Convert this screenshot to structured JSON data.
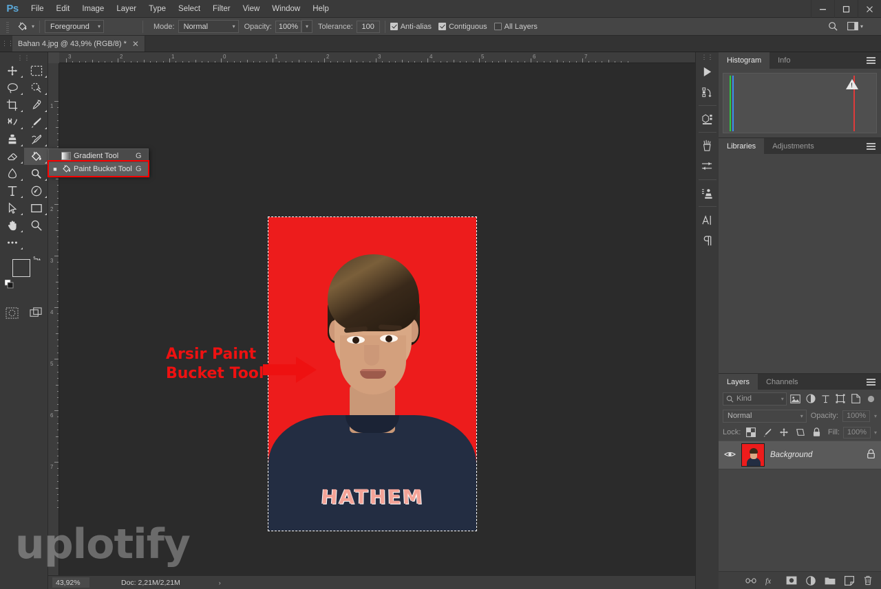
{
  "app": {
    "logo": "Ps",
    "menus": [
      "File",
      "Edit",
      "Image",
      "Layer",
      "Type",
      "Select",
      "Filter",
      "View",
      "Window",
      "Help"
    ],
    "window_controls": {
      "minimize": "—",
      "maximize": "□",
      "close": "✕"
    }
  },
  "options_bar": {
    "tool_icon": "paint-bucket-icon",
    "fill_source": "Foreground",
    "mode_label": "Mode:",
    "mode_value": "Normal",
    "opacity_label": "Opacity:",
    "opacity_value": "100%",
    "tolerance_label": "Tolerance:",
    "tolerance_value": "100",
    "antialias_label": "Anti-alias",
    "antialias_checked": true,
    "contiguous_label": "Contiguous",
    "contiguous_checked": true,
    "all_layers_label": "All Layers",
    "all_layers_checked": false,
    "search_icon": "search-icon",
    "workspace_icon": "workspace-icon"
  },
  "document_tab": {
    "title": "Bahan 4.jpg @ 43,9% (RGB/8) *",
    "close": "✕"
  },
  "toolbar": {
    "tools": [
      {
        "name": "move-tool",
        "glyph": "move"
      },
      {
        "name": "rectangular-marquee-tool",
        "glyph": "marquee"
      },
      {
        "name": "lasso-tool",
        "glyph": "lasso"
      },
      {
        "name": "quick-selection-tool",
        "glyph": "quickselect"
      },
      {
        "name": "crop-tool",
        "glyph": "crop"
      },
      {
        "name": "eyedropper-tool",
        "glyph": "eyedropper"
      },
      {
        "name": "healing-brush-tool",
        "glyph": "heal"
      },
      {
        "name": "brush-tool",
        "glyph": "brush"
      },
      {
        "name": "clone-stamp-tool",
        "glyph": "stamp"
      },
      {
        "name": "history-brush-tool",
        "glyph": "historybrush"
      },
      {
        "name": "eraser-tool",
        "glyph": "eraser"
      },
      {
        "name": "paint-bucket-tool",
        "glyph": "bucket"
      },
      {
        "name": "blur-tool",
        "glyph": "blur"
      },
      {
        "name": "dodge-tool",
        "glyph": "dodge"
      },
      {
        "name": "type-tool",
        "glyph": "type"
      },
      {
        "name": "pen-tool",
        "glyph": "pen"
      },
      {
        "name": "path-selection-tool",
        "glyph": "pathselect"
      },
      {
        "name": "rectangle-tool",
        "glyph": "rectangle"
      },
      {
        "name": "hand-tool",
        "glyph": "hand"
      },
      {
        "name": "zoom-tool",
        "glyph": "zoom"
      },
      {
        "name": "edit-toolbar-tool",
        "glyph": "ellipsis"
      }
    ],
    "foreground_color": "#ed1c24",
    "background_color": "#1a3fd8",
    "swap_icon": "swap-colors-icon",
    "default_colors_icon": "default-colors-icon",
    "quickmask_icon": "quick-mask-icon",
    "screenmode_icon": "screen-mode-icon"
  },
  "tool_flyout": {
    "items": [
      {
        "label": "Gradient Tool",
        "shortcut": "G",
        "icon": "gradient-icon",
        "selected": false
      },
      {
        "label": "Paint Bucket Tool",
        "shortcut": "G",
        "icon": "paint-bucket-icon",
        "selected": true
      }
    ],
    "highlight_color": "#ff0000"
  },
  "annotation": {
    "line1": "Arsir Paint",
    "line2": "Bucket Tool",
    "color": "#ee1111",
    "arrow": "arrow-right-icon"
  },
  "rulers": {
    "horizontal_labels": [
      "3",
      "2",
      "1",
      "0",
      "1",
      "2",
      "3",
      "4",
      "5",
      "6",
      "7"
    ],
    "vertical_labels": [
      "1",
      "1",
      "2",
      "3",
      "4",
      "5",
      "6",
      "7"
    ],
    "unit": "inches"
  },
  "canvas": {
    "background_color": "#ed1c1c",
    "shirt_text": "HATHEM",
    "selection": "marching-ants-selection"
  },
  "status_bar": {
    "zoom": "43,92%",
    "doc_info": "Doc: 2,21M/2,21M",
    "expand_arrow": "›"
  },
  "icon_dock": [
    {
      "name": "actions-play-icon",
      "glyph": "play"
    },
    {
      "name": "history-icon",
      "glyph": "history"
    },
    {
      "name": "3d-icon",
      "glyph": "cube"
    },
    {
      "name": "brushes-icon",
      "glyph": "brushes"
    },
    {
      "name": "adjustments-icon",
      "glyph": "sliders"
    },
    {
      "name": "clone-source-icon",
      "glyph": "clonesource"
    },
    {
      "name": "character-icon",
      "glyph": "character"
    },
    {
      "name": "paragraph-icon",
      "glyph": "paragraph"
    }
  ],
  "histogram_panel": {
    "tabs": [
      {
        "label": "Histogram",
        "active": true
      },
      {
        "label": "Info",
        "active": false
      }
    ],
    "menu_icon": "panel-menu-icon",
    "warning_icon": "cached-data-warning-icon",
    "channels": [
      {
        "name": "green-blue-peak",
        "color": "#2ecc40",
        "position_pct": 4
      },
      {
        "name": "blue-peak",
        "color": "#3b8ff0",
        "position_pct": 5
      },
      {
        "name": "red-peak",
        "color": "#e03b3b",
        "position_pct": 85
      }
    ]
  },
  "libraries_panel": {
    "tabs": [
      {
        "label": "Libraries",
        "active": true
      },
      {
        "label": "Adjustments",
        "active": false
      }
    ],
    "menu_icon": "panel-menu-icon"
  },
  "layers_panel": {
    "tabs": [
      {
        "label": "Layers",
        "active": true
      },
      {
        "label": "Channels",
        "active": false
      }
    ],
    "menu_icon": "panel-menu-icon",
    "filter": {
      "search_icon": "search-icon",
      "kind_label": "Kind",
      "icons": [
        "pixel-filter-icon",
        "adjustment-filter-icon",
        "type-filter-icon",
        "shape-filter-icon",
        "smart-object-filter-icon"
      ],
      "toggle_icon": "filter-toggle-icon"
    },
    "blend_mode": "Normal",
    "opacity_label": "Opacity:",
    "opacity_value": "100%",
    "lock_label": "Lock:",
    "lock_icons": [
      "lock-transparency-icon",
      "lock-image-icon",
      "lock-position-icon",
      "lock-artboard-icon",
      "lock-all-icon"
    ],
    "fill_label": "Fill:",
    "fill_value": "100%",
    "layers": [
      {
        "name": "Background",
        "visible": true,
        "locked": true,
        "eye_icon": "eye-icon",
        "lock_icon": "lock-icon",
        "thumbnail": "portrait-red-background-thumbnail"
      }
    ],
    "footer_icons": [
      {
        "name": "link-layers-icon",
        "glyph": "link"
      },
      {
        "name": "layer-style-fx-icon",
        "glyph": "fx"
      },
      {
        "name": "add-layer-mask-icon",
        "glyph": "mask"
      },
      {
        "name": "new-adjustment-layer-icon",
        "glyph": "adjustment"
      },
      {
        "name": "new-group-icon",
        "glyph": "folder"
      },
      {
        "name": "new-layer-icon",
        "glyph": "newlayer"
      },
      {
        "name": "delete-layer-icon",
        "glyph": "trash"
      }
    ]
  },
  "watermark": {
    "text": "uplotify"
  }
}
